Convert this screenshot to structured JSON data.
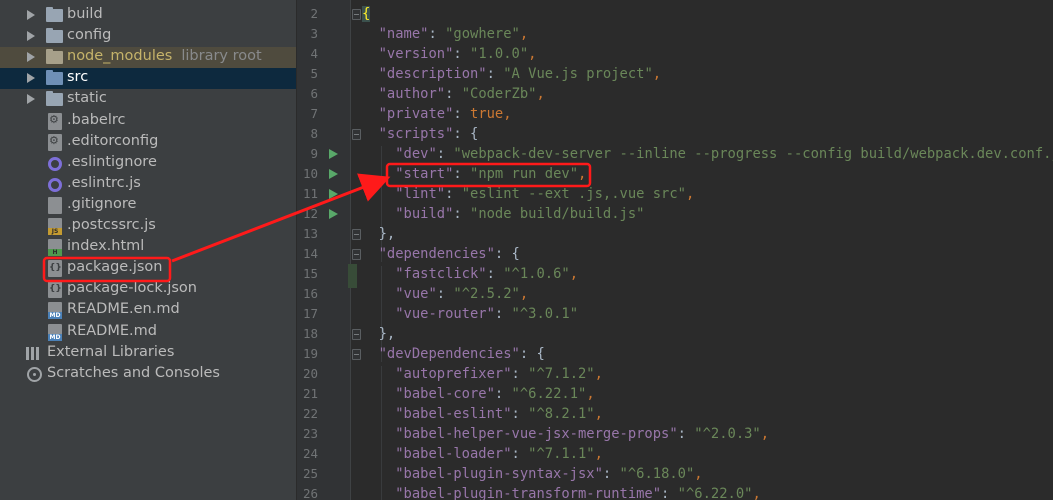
{
  "project_tree": {
    "items": [
      {
        "label": "build",
        "kind": "folder",
        "expandable": true
      },
      {
        "label": "config",
        "kind": "folder",
        "expandable": true
      },
      {
        "label": "node_modules",
        "hint": "library root",
        "kind": "folder",
        "expandable": true
      },
      {
        "label": "src",
        "kind": "folder",
        "expandable": true,
        "selected": true
      },
      {
        "label": "static",
        "kind": "folder",
        "expandable": true
      },
      {
        "label": ".babelrc",
        "kind": "file",
        "icon": "config-file-icon"
      },
      {
        "label": ".editorconfig",
        "kind": "file",
        "icon": "gear-icon"
      },
      {
        "label": ".eslintignore",
        "kind": "file",
        "icon": "eslint-icon"
      },
      {
        "label": ".eslintrc.js",
        "kind": "file",
        "icon": "eslint-icon"
      },
      {
        "label": ".gitignore",
        "kind": "file",
        "icon": "git-file-icon"
      },
      {
        "label": ".postcssrc.js",
        "kind": "file",
        "icon": "js-file-icon"
      },
      {
        "label": "index.html",
        "kind": "file",
        "icon": "html-file-icon"
      },
      {
        "label": "package.json",
        "kind": "file",
        "icon": "json-file-icon"
      },
      {
        "label": "package-lock.json",
        "kind": "file",
        "icon": "json-file-icon"
      },
      {
        "label": "README.en.md",
        "kind": "file",
        "icon": "markdown-file-icon"
      },
      {
        "label": "README.md",
        "kind": "file",
        "icon": "markdown-file-icon"
      },
      {
        "label": "External Libraries",
        "kind": "libraries",
        "icon": "libraries-icon"
      },
      {
        "label": "Scratches and Consoles",
        "kind": "scratches",
        "icon": "scratches-icon"
      }
    ]
  },
  "editor": {
    "lines": [
      {
        "n": "2",
        "code": [
          [
            "brace-hl",
            "{"
          ]
        ]
      },
      {
        "n": "3",
        "code": [
          [
            "plain",
            "  "
          ],
          [
            "key",
            "\"name\""
          ],
          [
            "plain",
            ": "
          ],
          [
            "str",
            "\"gowhere\""
          ],
          [
            "punc",
            ","
          ]
        ]
      },
      {
        "n": "4",
        "code": [
          [
            "plain",
            "  "
          ],
          [
            "key",
            "\"version\""
          ],
          [
            "plain",
            ": "
          ],
          [
            "str",
            "\"1.0.0\""
          ],
          [
            "punc",
            ","
          ]
        ]
      },
      {
        "n": "5",
        "code": [
          [
            "plain",
            "  "
          ],
          [
            "key",
            "\"description\""
          ],
          [
            "plain",
            ": "
          ],
          [
            "str",
            "\"A Vue.js project\""
          ],
          [
            "punc",
            ","
          ]
        ]
      },
      {
        "n": "6",
        "code": [
          [
            "plain",
            "  "
          ],
          [
            "key",
            "\"author\""
          ],
          [
            "plain",
            ": "
          ],
          [
            "str",
            "\"CoderZb\""
          ],
          [
            "punc",
            ","
          ]
        ]
      },
      {
        "n": "7",
        "code": [
          [
            "plain",
            "  "
          ],
          [
            "key",
            "\"private\""
          ],
          [
            "plain",
            ": "
          ],
          [
            "kw",
            "true"
          ],
          [
            "punc",
            ","
          ]
        ]
      },
      {
        "n": "8",
        "code": [
          [
            "plain",
            "  "
          ],
          [
            "key",
            "\"scripts\""
          ],
          [
            "plain",
            ": {"
          ]
        ]
      },
      {
        "n": "9",
        "code": [
          [
            "plain",
            "    "
          ],
          [
            "key",
            "\"dev\""
          ],
          [
            "plain",
            ": "
          ],
          [
            "str",
            "\"webpack-dev-server --inline --progress --config build/webpack.dev.conf.js\""
          ],
          [
            "punc",
            ","
          ]
        ]
      },
      {
        "n": "10",
        "code": [
          [
            "plain",
            "    "
          ],
          [
            "key",
            "\"start\""
          ],
          [
            "plain",
            ": "
          ],
          [
            "str",
            "\"npm run dev\""
          ],
          [
            "punc",
            ","
          ]
        ]
      },
      {
        "n": "11",
        "code": [
          [
            "plain",
            "    "
          ],
          [
            "key",
            "\"lint\""
          ],
          [
            "plain",
            ": "
          ],
          [
            "str",
            "\"eslint --ext .js,.vue src\""
          ],
          [
            "punc",
            ","
          ]
        ]
      },
      {
        "n": "12",
        "code": [
          [
            "plain",
            "    "
          ],
          [
            "key",
            "\"build\""
          ],
          [
            "plain",
            ": "
          ],
          [
            "str",
            "\"node build/build.js\""
          ]
        ]
      },
      {
        "n": "13",
        "code": [
          [
            "plain",
            "  },"
          ]
        ]
      },
      {
        "n": "14",
        "code": [
          [
            "plain",
            "  "
          ],
          [
            "key",
            "\"dependencies\""
          ],
          [
            "plain",
            ": {"
          ]
        ]
      },
      {
        "n": "15",
        "code": [
          [
            "plain",
            "    "
          ],
          [
            "key",
            "\"fastclick\""
          ],
          [
            "plain",
            ": "
          ],
          [
            "str",
            "\"^1.0.6\""
          ],
          [
            "punc",
            ","
          ]
        ]
      },
      {
        "n": "16",
        "code": [
          [
            "plain",
            "    "
          ],
          [
            "key",
            "\"vue\""
          ],
          [
            "plain",
            ": "
          ],
          [
            "str",
            "\"^2.5.2\""
          ],
          [
            "punc",
            ","
          ]
        ]
      },
      {
        "n": "17",
        "code": [
          [
            "plain",
            "    "
          ],
          [
            "key",
            "\"vue-router\""
          ],
          [
            "plain",
            ": "
          ],
          [
            "str",
            "\"^3.0.1\""
          ]
        ]
      },
      {
        "n": "18",
        "code": [
          [
            "plain",
            "  },"
          ]
        ]
      },
      {
        "n": "19",
        "code": [
          [
            "plain",
            "  "
          ],
          [
            "key",
            "\"devDependencies\""
          ],
          [
            "plain",
            ": {"
          ]
        ]
      },
      {
        "n": "20",
        "code": [
          [
            "plain",
            "    "
          ],
          [
            "key",
            "\"autoprefixer\""
          ],
          [
            "plain",
            ": "
          ],
          [
            "str",
            "\"^7.1.2\""
          ],
          [
            "punc",
            ","
          ]
        ]
      },
      {
        "n": "21",
        "code": [
          [
            "plain",
            "    "
          ],
          [
            "key",
            "\"babel-core\""
          ],
          [
            "plain",
            ": "
          ],
          [
            "str",
            "\"^6.22.1\""
          ],
          [
            "punc",
            ","
          ]
        ]
      },
      {
        "n": "22",
        "code": [
          [
            "plain",
            "    "
          ],
          [
            "key",
            "\"babel-eslint\""
          ],
          [
            "plain",
            ": "
          ],
          [
            "str",
            "\"^8.2.1\""
          ],
          [
            "punc",
            ","
          ]
        ]
      },
      {
        "n": "23",
        "code": [
          [
            "plain",
            "    "
          ],
          [
            "key",
            "\"babel-helper-vue-jsx-merge-props\""
          ],
          [
            "plain",
            ": "
          ],
          [
            "str",
            "\"^2.0.3\""
          ],
          [
            "punc",
            ","
          ]
        ]
      },
      {
        "n": "24",
        "code": [
          [
            "plain",
            "    "
          ],
          [
            "key",
            "\"babel-loader\""
          ],
          [
            "plain",
            ": "
          ],
          [
            "str",
            "\"^7.1.1\""
          ],
          [
            "punc",
            ","
          ]
        ]
      },
      {
        "n": "25",
        "code": [
          [
            "plain",
            "    "
          ],
          [
            "key",
            "\"babel-plugin-syntax-jsx\""
          ],
          [
            "plain",
            ": "
          ],
          [
            "str",
            "\"^6.18.0\""
          ],
          [
            "punc",
            ","
          ]
        ]
      },
      {
        "n": "26",
        "code": [
          [
            "plain",
            "    "
          ],
          [
            "key",
            "\"babel-plugin-transform-runtime\""
          ],
          [
            "plain",
            ": "
          ],
          [
            "str",
            "\"^6.22.0\""
          ],
          [
            "punc",
            ","
          ]
        ]
      }
    ],
    "run_markers_on_lines": [
      "9",
      "10",
      "11",
      "12"
    ],
    "fold_markers_on_lines": [
      "2",
      "8",
      "13",
      "14",
      "18",
      "19"
    ]
  },
  "annotation": {
    "color": "#ff1a1a",
    "highlighted_file": "package.json",
    "highlighted_code": "\"start\": \"npm run dev\","
  }
}
